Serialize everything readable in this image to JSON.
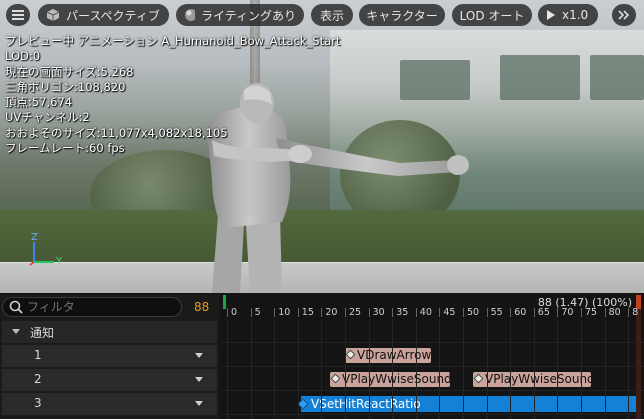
{
  "toolbar": {
    "menu_icon": "hamburger-icon",
    "perspective_label": "パースペクティブ",
    "lighting_label": "ライティングあり",
    "show_label": "表示",
    "character_label": "キャラクター",
    "lod_label": "LOD オート",
    "speed_label": "x1.0",
    "expand_icon": "double-chevron-right-icon"
  },
  "stats": {
    "preview": "プレビュー中 アニメーション A_Humanoid_Bow_Attack_Start",
    "lod": "LOD:0",
    "screen_size": "現在の画面サイズ:5.268",
    "triangles": "三角ポリゴン:108,820",
    "vertices": "頂点:57,674",
    "uv_channels": "UVチャンネル:2",
    "approx_size": "おおよそのサイズ:11,077x4,082x18,105",
    "framerate": "フレームレート:60 fps"
  },
  "gizmo": {
    "z": "Z",
    "y": "Y"
  },
  "tracks": {
    "filter_placeholder": "フィルタ",
    "count": "88",
    "notify_header": "通知",
    "rows": [
      "1",
      "2",
      "3"
    ]
  },
  "timeline": {
    "frame_readout": "88 (1.47) (100%)",
    "ticks": [
      "0",
      "5",
      "10",
      "15",
      "20",
      "25",
      "30",
      "35",
      "40",
      "45",
      "50",
      "55",
      "60",
      "65",
      "70",
      "75",
      "80",
      "8"
    ],
    "notifies": {
      "row1": [
        "VDrawArrow"
      ],
      "row2": [
        "VPlayWwiseSound",
        "VPlayWwiseSound"
      ],
      "row3": [
        "VSetHitReactRatio"
      ]
    }
  },
  "colors": {
    "accent_count": "#e59a2c",
    "notify_fill": "#c9a39c",
    "state_fill": "#1581d6",
    "axis_z": "#3b82f6",
    "axis_y": "#22c55e",
    "axis_x": "#ef4444"
  }
}
